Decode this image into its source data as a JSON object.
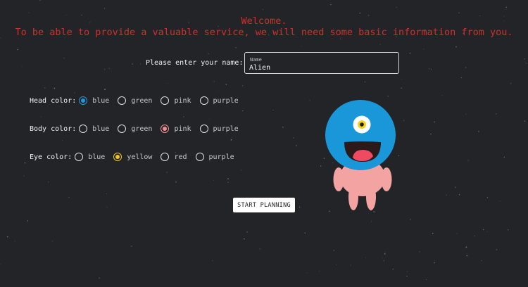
{
  "header": {
    "line1": "Welcome.",
    "line2": "To be able to provide a valuable service, we will need some basic information from you."
  },
  "name_prompt": {
    "label": "Please enter your name:",
    "field_label": "Name",
    "value": "Alien"
  },
  "head_color": {
    "label": "Head color:",
    "selected": "blue",
    "accent": "#1f9ad6",
    "options": [
      "blue",
      "green",
      "pink",
      "purple"
    ]
  },
  "body_color": {
    "label": "Body color:",
    "selected": "pink",
    "accent": "#f08f8f",
    "options": [
      "blue",
      "green",
      "pink",
      "purple"
    ]
  },
  "eye_color": {
    "label": "Eye color:",
    "selected": "yellow",
    "accent": "#f2c916",
    "options": [
      "blue",
      "yellow",
      "red",
      "purple"
    ]
  },
  "start_button": {
    "label": "START PLANNING"
  },
  "avatar_colors": {
    "head": "#1a97d9",
    "body": "#f4a3a3",
    "eye": "#f5d31a",
    "mouth": "#2a1a1a",
    "tongue": "#ee4b63"
  },
  "background_color": "#222427"
}
